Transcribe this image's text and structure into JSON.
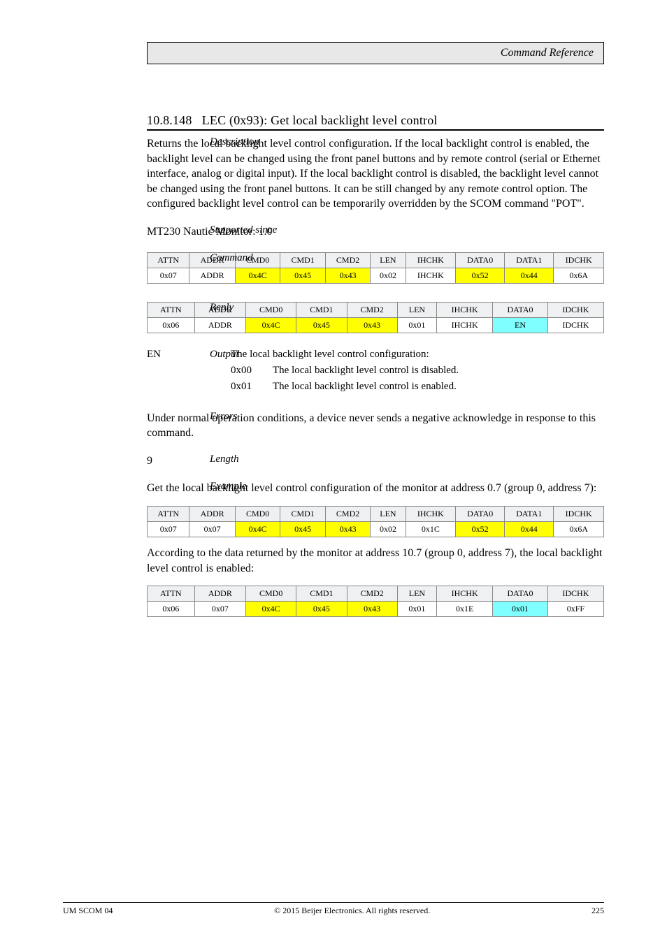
{
  "header": {
    "title": "Command Reference"
  },
  "section": {
    "number": "10.8.148",
    "title": "LEC (0x93): Get local backlight level control"
  },
  "labels": {
    "description": "Description",
    "since": "Supported since",
    "command": "Command",
    "reply": "Reply",
    "output": "Output",
    "errors": "Errors",
    "length": "Length",
    "example": "Example"
  },
  "description_text": "Returns the local backlight level control configuration. If the local backlight control is enabled, the backlight level can be changed using the front panel buttons and by remote control (serial or Ethernet interface, analog or digital input). If the local backlight control is disabled, the backlight level cannot be changed using the front panel buttons. It can be still changed by any remote control option. The configured backlight level control can be temporarily overridden by the SCOM command \"POT\".",
  "since_text": "MT230 Nautic Monitor: 1.0",
  "cmd_headers": [
    "ATTN",
    "ADDR",
    "CMD0",
    "CMD1",
    "CMD2",
    "LEN",
    "IHCHK",
    "DATA0",
    "DATA1",
    "IDCHK"
  ],
  "reply_headers": [
    "ATTN",
    "ADDR",
    "CMD0",
    "CMD1",
    "CMD2",
    "LEN",
    "IHCHK",
    "DATA0",
    "IDCHK"
  ],
  "cmd_row": [
    "0x07",
    "ADDR",
    "0x4C",
    "0x45",
    "0x43",
    "0x02",
    "IHCHK",
    "0x52",
    "0x44",
    "0x6A"
  ],
  "reply_row": [
    "0x06",
    "ADDR",
    "0x4C",
    "0x45",
    "0x43",
    "0x01",
    "IHCHK",
    "EN",
    "IDCHK"
  ],
  "field": {
    "name": "EN",
    "desc": "The local backlight level control configuration:"
  },
  "field_values": {
    "v0x00": "0x00",
    "d0x00": "The local backlight level control is disabled.",
    "v0x01": "0x01",
    "d0x01": "The local backlight level control is enabled."
  },
  "errors_text": "Under normal operation conditions, a device never sends a negative acknowledge in response to this command.",
  "length_text": "9",
  "example_intro": "Get the local backlight level control configuration of the monitor at address 0.7 (group 0, address 7):",
  "ex_cmd_row": [
    "0x07",
    "0x07",
    "0x4C",
    "0x45",
    "0x43",
    "0x02",
    "0x1C",
    "0x52",
    "0x44",
    "0x6A"
  ],
  "example_reply_intro": "According to the data returned by the monitor at address 10.7 (group 0, address 7), the local backlight level control is enabled:",
  "ex_reply_row": [
    "0x06",
    "0x07",
    "0x4C",
    "0x45",
    "0x43",
    "0x01",
    "0x1E",
    "0x01",
    "0xFF"
  ],
  "footer": {
    "left": "UM SCOM 04",
    "center": "© 2015 Beijer Electronics. All rights reserved.",
    "right": "225"
  }
}
